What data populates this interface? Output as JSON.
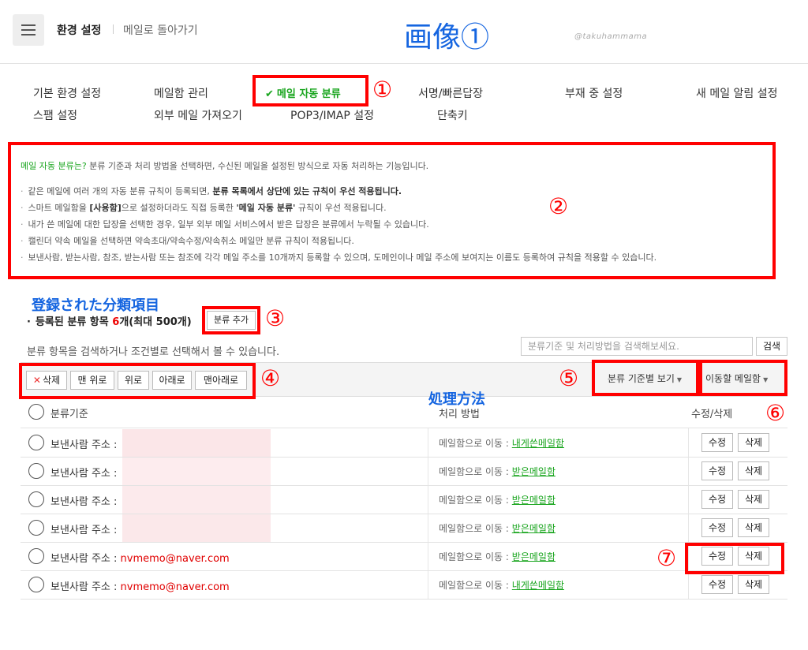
{
  "header": {
    "title": "환경 설정",
    "back_link": "메일로 돌아가기",
    "annotation_title": "画像①",
    "watermark": "@takuhammama"
  },
  "tabs": {
    "row1": [
      "기본 환경 설정",
      "메일함 관리",
      "메일 자동 분류",
      "서명/빠른답장",
      "부재 중 설정",
      "새 메일 알림 설정"
    ],
    "row2": [
      "스팸 설정",
      "외부 메일 가져오기",
      "POP3/IMAP 설정",
      "단축키"
    ],
    "active": "메일 자동 분류"
  },
  "annotations": {
    "c1": "①",
    "c2": "②",
    "c3": "③",
    "c4": "④",
    "c5": "⑤",
    "c6": "⑥",
    "c7": "⑦",
    "registered_note": "登録された分類項目",
    "process_note": "処理方法"
  },
  "info": {
    "lead": "메일 자동 분류는?",
    "lead_rest": " 분류 기준과 처리 방법을 선택하면, 수신된 메일을 설정된 방식으로 자동 처리하는 기능입니다.",
    "b1_pre": "같은 메일에 여러 개의 자동 분류 규칙이 등록되면, ",
    "b1_bold": "분류 목록에서 상단에 있는 규칙이 우선 적용됩니다.",
    "b2_pre": "스마트 메일함을 ",
    "b2_bold1": "[사용함]",
    "b2_mid": "으로 설정하더라도 직접 등록한 ",
    "b2_bold2": "'메일 자동 분류'",
    "b2_post": " 규칙이 우선 적용됩니다.",
    "b3": "내가 쓴 메일에 대한 답장을 선택한 경우, 일부 외부 메일 서비스에서 받은 답장은 분류에서 누락될 수 있습니다.",
    "b4": "캘린더 약속 메일을 선택하면 약속초대/약속수정/약속취소 메일만 분류 규칙이 적용됩니다.",
    "b5": "보낸사람, 받는사람, 참조, 받는사람 또는 참조에 각각 메일 주소를 10개까지 등록할 수 있으며, 도메인이나 메일 주소에 보여지는 이름도 등록하여 규칙을 적용할 수 있습니다."
  },
  "registered": {
    "label": "등록된 분류 항목",
    "count": "6",
    "suffix": "개(최대 500개)",
    "add_button": "분류 추가",
    "description": "분류 항목을 검색하거나 조건별로 선택해서 볼 수 있습니다.",
    "search_placeholder": "분류기준 및 처리방법을 검색해보세요.",
    "search_button": "검색"
  },
  "toolbar": {
    "delete": "삭제",
    "top": "맨 위로",
    "up": "위로",
    "down": "아래로",
    "bottom": "맨아래로",
    "view_by": "분류 기준별 보기",
    "move_to": "이동할 메일함"
  },
  "table": {
    "col_criteria": "분류기준",
    "col_action": "처리 방법",
    "col_edit": "수정/삭제",
    "edit_label": "수정",
    "delete_label": "삭제",
    "rows": [
      {
        "sender_label": "보낸사람 주소 :",
        "email": "",
        "action": "메일함으로 이동 :",
        "folder": "내게쓴메일함"
      },
      {
        "sender_label": "보낸사람 주소 :",
        "email": "",
        "action": "메일함으로 이동 :",
        "folder": "받은메일함"
      },
      {
        "sender_label": "보낸사람 주소 :",
        "email": "",
        "action": "메일함으로 이동 :",
        "folder": "받은메일함"
      },
      {
        "sender_label": "보낸사람 주소 :",
        "email": "",
        "action": "메일함으로 이동 :",
        "folder": "받은메일함"
      },
      {
        "sender_label": "보낸사람 주소 :",
        "email": "nvmemo@naver.com",
        "action": "메일함으로 이동 :",
        "folder": "받은메일함"
      },
      {
        "sender_label": "보낸사람 주소 :",
        "email": "nvmemo@naver.com",
        "action": "메일함으로 이동 :",
        "folder": "내게쓴메일함"
      }
    ]
  },
  "colors": {
    "accent_green": "#19a51e",
    "annotation_red": "#ff0000",
    "annotation_blue": "#1565e0",
    "count_red": "#e00000"
  }
}
